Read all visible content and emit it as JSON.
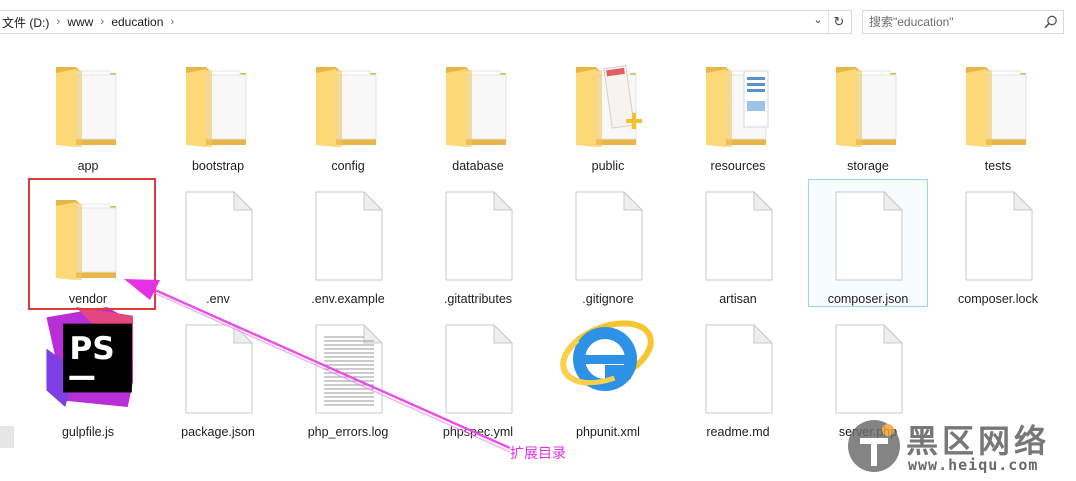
{
  "address_bar": {
    "crumbs": [
      "文件 (D:)",
      "www",
      "education"
    ],
    "dropdown_glyph": "⌄",
    "refresh_glyph": "↻",
    "chevron_glyph": "›"
  },
  "search": {
    "placeholder": "搜索\"education\""
  },
  "items": [
    {
      "name": "app",
      "kind": "folder"
    },
    {
      "name": "bootstrap",
      "kind": "folder"
    },
    {
      "name": "config",
      "kind": "folder"
    },
    {
      "name": "database",
      "kind": "folder"
    },
    {
      "name": "public",
      "kind": "folder-special"
    },
    {
      "name": "resources",
      "kind": "folder-docs"
    },
    {
      "name": "storage",
      "kind": "folder"
    },
    {
      "name": "tests",
      "kind": "folder"
    },
    {
      "name": "vendor",
      "kind": "folder"
    },
    {
      "name": ".env",
      "kind": "file"
    },
    {
      "name": ".env.example",
      "kind": "file"
    },
    {
      "name": ".gitattributes",
      "kind": "file"
    },
    {
      "name": ".gitignore",
      "kind": "file"
    },
    {
      "name": "artisan",
      "kind": "file"
    },
    {
      "name": "composer.json",
      "kind": "file",
      "selected": true
    },
    {
      "name": "composer.lock",
      "kind": "file"
    },
    {
      "name": "gulpfile.js",
      "kind": "phpstorm"
    },
    {
      "name": "package.json",
      "kind": "file"
    },
    {
      "name": "php_errors.log",
      "kind": "file-text"
    },
    {
      "name": "phpspec.yml",
      "kind": "file"
    },
    {
      "name": "phpunit.xml",
      "kind": "ie"
    },
    {
      "name": "readme.md",
      "kind": "file"
    },
    {
      "name": "server.php",
      "kind": "file"
    }
  ],
  "icons": {
    "phpstorm_text": "PS"
  },
  "annotation": {
    "text": "扩展目录",
    "color": "#e431e4",
    "box_color": "#e03a3a"
  },
  "watermark": {
    "text": "黑区网络",
    "url": "www.heiqu.com"
  },
  "colors": {
    "folder_back": "#e8b548",
    "folder_front": "#fcd877",
    "selection_border": "#99d1ff"
  }
}
